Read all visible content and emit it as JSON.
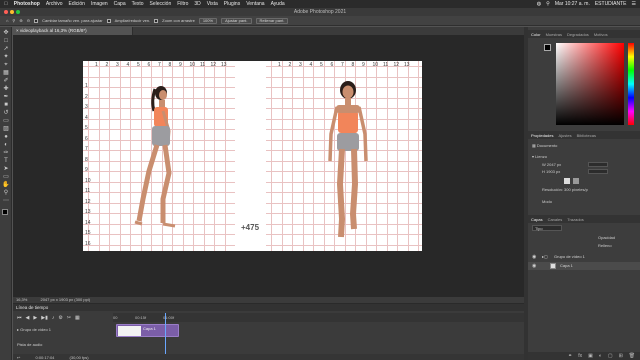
{
  "menubar": {
    "apple": "",
    "app_name": "Photoshop",
    "items": [
      "Archivo",
      "Edición",
      "Imagen",
      "Capa",
      "Texto",
      "Selección",
      "Filtro",
      "3D",
      "Vista",
      "Plugins",
      "Ventana",
      "Ayuda"
    ],
    "clock": "Mar 10:27 a. m.",
    "user": "ESTUDIANTE"
  },
  "window": {
    "title": "Adobe Photoshop 2021"
  },
  "options_bar": {
    "resize_windows": "Cambiar tamaño ven. para ajustar",
    "zoom_all": "Ampliar/reducir ven.",
    "scrubby_zoom": "Zoom con arrastre",
    "zoom_100": "100%",
    "fit_screen": "Ajustar pant.",
    "fill_screen": "Rellenar pant."
  },
  "document": {
    "tab_title": "videoplayback al 16,3% (RGB/8*)",
    "overlay_number": "+475",
    "ruler_top_left": [
      "1",
      "2",
      "3",
      "4",
      "5",
      "6",
      "7",
      "8",
      "9",
      "10",
      "11",
      "12",
      "13"
    ],
    "ruler_top_right": [
      "1",
      "2",
      "3",
      "4",
      "5",
      "6",
      "7",
      "8",
      "9",
      "10",
      "11",
      "12",
      "13"
    ],
    "ruler_left": [
      "1",
      "2",
      "3",
      "4",
      "5",
      "6",
      "7",
      "8",
      "9",
      "10",
      "11",
      "12",
      "13",
      "14",
      "15",
      "16"
    ]
  },
  "status": {
    "zoom": "16,3%",
    "size": "2047 px x 1903 px (300 ppi)"
  },
  "timeline": {
    "panel_title": "Línea de tiempo",
    "ruler_marks": [
      "00",
      "00:15f",
      "01:00f"
    ],
    "track_group": "Grupo de vídeo 1",
    "track_audio": "Pista de audio",
    "clip_name": "Capa 1",
    "timecode": "0:00:17:04",
    "fps": "(30,00 fps)"
  },
  "color_panel": {
    "tabs": [
      "Color",
      "Muestras",
      "Degradados",
      "Motivos"
    ],
    "active_tab": "Color",
    "foreground": "#000000",
    "background": "#ffffff"
  },
  "properties_panel": {
    "tabs": [
      "Propiedades",
      "Ajustes",
      "Bibliotecas"
    ],
    "section": "Documento",
    "canvas_label": "Lienzo",
    "width": "2047 px",
    "height": "1903 px",
    "resolution": "Resolución: 300 píxeles/p",
    "mode_label": "Modo"
  },
  "layers_panel": {
    "tabs": [
      "Capas",
      "Canales",
      "Trazados"
    ],
    "filter_label": "Tipo",
    "opacity_label": "Opacidad",
    "fill_label": "Relleno",
    "layers": [
      {
        "name": "Grupo de vídeo 1",
        "type": "group"
      },
      {
        "name": "Capa 1",
        "type": "layer"
      }
    ]
  },
  "tools": [
    "move",
    "marquee",
    "lasso",
    "quick-select",
    "crop",
    "frame",
    "eyedropper",
    "healing",
    "brush",
    "stamp",
    "history",
    "eraser",
    "gradient",
    "blur",
    "dodge",
    "pen",
    "type",
    "path-select",
    "shape",
    "hand",
    "zoom",
    "edit-toolbar"
  ]
}
